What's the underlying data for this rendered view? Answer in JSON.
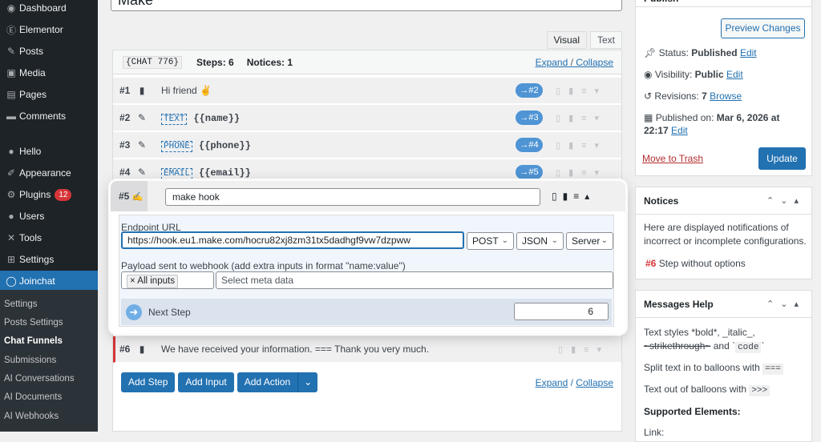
{
  "sidebar": {
    "items": [
      {
        "icon": "dashboard-icon",
        "glyph": "◉",
        "label": "Dashboard"
      },
      {
        "icon": "elementor-icon",
        "glyph": "Ⓔ",
        "label": "Elementor"
      },
      {
        "icon": "pin-icon",
        "glyph": "✎",
        "label": "Posts"
      },
      {
        "icon": "media-icon",
        "glyph": "▣",
        "label": "Media"
      },
      {
        "icon": "pages-icon",
        "glyph": "▤",
        "label": "Pages"
      },
      {
        "icon": "comments-icon",
        "glyph": "▬",
        "label": "Comments"
      },
      {
        "icon": "hello-icon",
        "glyph": "●",
        "label": "Hello"
      },
      {
        "icon": "appearance-icon",
        "glyph": "✐",
        "label": "Appearance"
      },
      {
        "icon": "plugins-icon",
        "glyph": "⚙",
        "label": "Plugins",
        "badge": "12"
      },
      {
        "icon": "users-icon",
        "glyph": "●",
        "label": "Users"
      },
      {
        "icon": "tools-icon",
        "glyph": "✕",
        "label": "Tools"
      },
      {
        "icon": "settings-icon",
        "glyph": "⊞",
        "label": "Settings"
      },
      {
        "icon": "joinchat-icon",
        "glyph": "◯",
        "label": "Joinchat"
      }
    ],
    "submenu": [
      "Settings",
      "Posts Settings",
      "Chat Funnels",
      "Submissions",
      "AI Conversations",
      "AI Documents",
      "AI Webhooks"
    ]
  },
  "main": {
    "title": "Make",
    "tabs": [
      "Visual",
      "Text"
    ],
    "header": {
      "chat_id": "{CHAT 776}",
      "steps": "Steps: 6",
      "notices": "Notices: 1",
      "expand": "Expand",
      "sep": " / ",
      "collapse": "Collapse"
    },
    "steps": [
      {
        "num": "#1",
        "text": "Hi friend ✌",
        "jump": "→#2"
      },
      {
        "num": "#2",
        "tag": "TEXT",
        "var": "{{name}}",
        "jump": "→#3"
      },
      {
        "num": "#3",
        "tag": "PHONE",
        "var": "{{phone}}",
        "jump": "→#4"
      },
      {
        "num": "#4",
        "tag": "EMAIL",
        "var": "{{email}}",
        "jump": "→#5"
      }
    ],
    "step6": {
      "num": "#6",
      "text": "We have received your information.  === Thank you very much."
    },
    "buttons": [
      "Add Step",
      "Add Input",
      "Add Action"
    ],
    "footer_expand": "Expand",
    "footer_collapse": "Collapse"
  },
  "card": {
    "num": "#5",
    "name": "make hook",
    "endpoint_label": "Endpoint URL",
    "endpoint": "https://hook.eu1.make.com/hocru82xj8zm31tx5dadhgf9vw7dzpww",
    "method": "POST",
    "format": "JSON",
    "mode": "Server",
    "payload_label": "Payload sent to webhook (add extra inputs in format \"name:value\")",
    "payload_chip": "× All inputs",
    "meta_placeholder": "Select meta data",
    "next_step_label": "Next Step",
    "next_step_value": "6"
  },
  "publish": {
    "title": "Publish",
    "preview": "Preview Changes",
    "status_label": "Status: ",
    "status": "Published",
    "status_edit": "Edit",
    "visibility_label": "Visibility: ",
    "visibility": "Public",
    "visibility_edit": "Edit",
    "revisions_label": "Revisions: ",
    "revisions": "7",
    "revisions_link": "Browse",
    "published_label": "Published on: ",
    "published": "Mar 6, 2026 at",
    "published_time": "22:17",
    "published_edit": "Edit",
    "trash": "Move to Trash",
    "update": "Update"
  },
  "notices": {
    "title": "Notices",
    "text": "Here are displayed notifications of incorrect or incomplete configurations.",
    "item_num": "#6",
    "item_text": " Step without options"
  },
  "help": {
    "title": "Messages Help",
    "styles_line1": "Text styles *bold*, _italic_,",
    "styles_strike": "~strikethrough~",
    "styles_and": " and `",
    "styles_code": "code",
    "styles_end": "`",
    "split": "Split text in to balloons with ",
    "split_code": "===",
    "out": "Text out of balloons with ",
    "out_code": ">>>",
    "supported": "Supported Elements:",
    "link": "Link:"
  },
  "colors": {
    "accent": "#2271b1",
    "sidebar": "#1d2327",
    "danger": "#d63638"
  }
}
